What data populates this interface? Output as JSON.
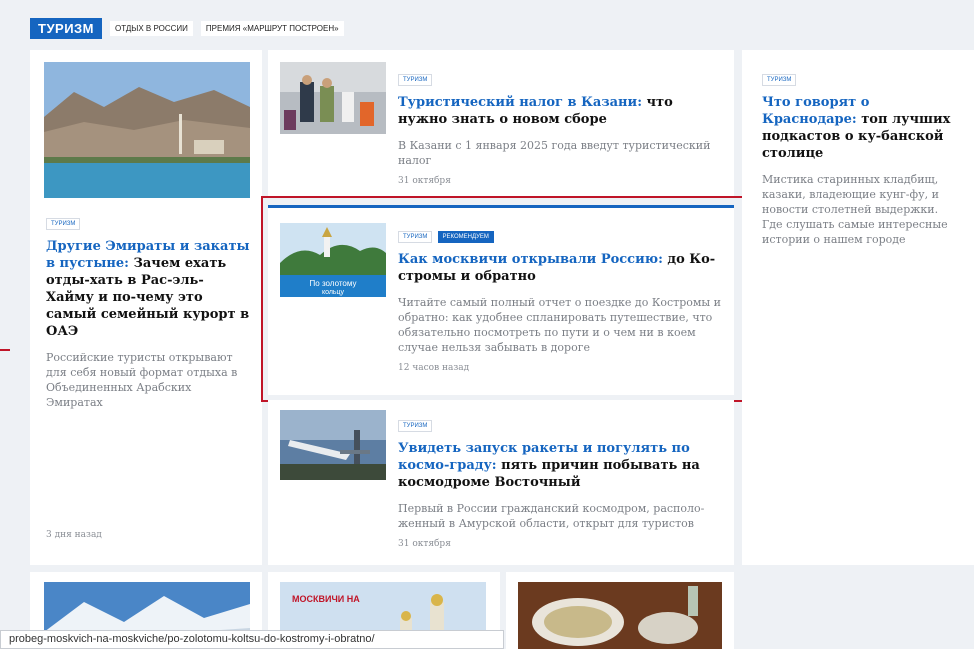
{
  "header": {
    "brand": "ТУРИЗМ",
    "links": [
      "ОТДЫХ В РОССИИ",
      "ПРЕМИЯ «МАРШРУТ ПОСТРОЕН»"
    ]
  },
  "cards": {
    "emirates": {
      "tag": "ТУРИЗМ",
      "title_hl": "Другие Эмираты и закаты в пустыне:",
      "title_rest": " Зачем ехать отды-хать в Рас-эль-Хайму и по-чему это самый семейный курорт в ОАЭ",
      "lead": "Российские туристы открывают для себя новый формат отдыха в Объединенных Арабских Эмиратах",
      "date": "3 дня назад"
    },
    "kazan": {
      "tag": "ТУРИЗМ",
      "title_hl": "Туристический налог в Казани:",
      "title_rest": " что нужно знать о новом сборе",
      "lead": "В Казани с 1 января 2025 года введут туристический налог",
      "date": "31 октября"
    },
    "kostroma": {
      "tag": "ТУРИЗМ",
      "tag2": "РЕКОМЕНДУЕМ",
      "title_hl": "Как москвичи открывали Россию:",
      "title_rest": " до Ко-стромы и обратно",
      "lead": "Читайте самый полный отчет о поездке до Костромы и обратно: как удобнее спланировать путешествие, что обязательно посмотреть по пути и о чем ни в коем случае нельзя забывать в дороге",
      "date": "12 часов назад",
      "image_text1": "По золотому",
      "image_text2": "кольцу"
    },
    "rocket": {
      "tag": "ТУРИЗМ",
      "title_hl": "Увидеть запуск ракеты и погулять по космо-граду:",
      "title_rest": " пять причин побывать на космодроме Восточный",
      "lead": "Первый в России гражданский космодром, располо-женный в Амурской области, открыт для туристов",
      "date": "31 октября"
    },
    "krasnodar": {
      "tag": "ТУРИЗМ",
      "title_hl": "Что говорят о Краснодаре:",
      "title_rest": " топ лучших подкастов о ку-банской столице",
      "lead": "Мистика старинных кладбищ, казаки, владеющие кунг-фу, и новости столетней выдержки. Где слушать самые интересные истории о нашем городе"
    }
  },
  "bottom": {
    "moscow_label": "МОСКВИЧИ НА"
  },
  "status_url": "probeg-moskvich-na-moskviche/po-zolotomu-koltsu-do-kostromy-i-obratno/",
  "colors": {
    "accent": "#1565c0",
    "highlight_box": "#c01528"
  }
}
